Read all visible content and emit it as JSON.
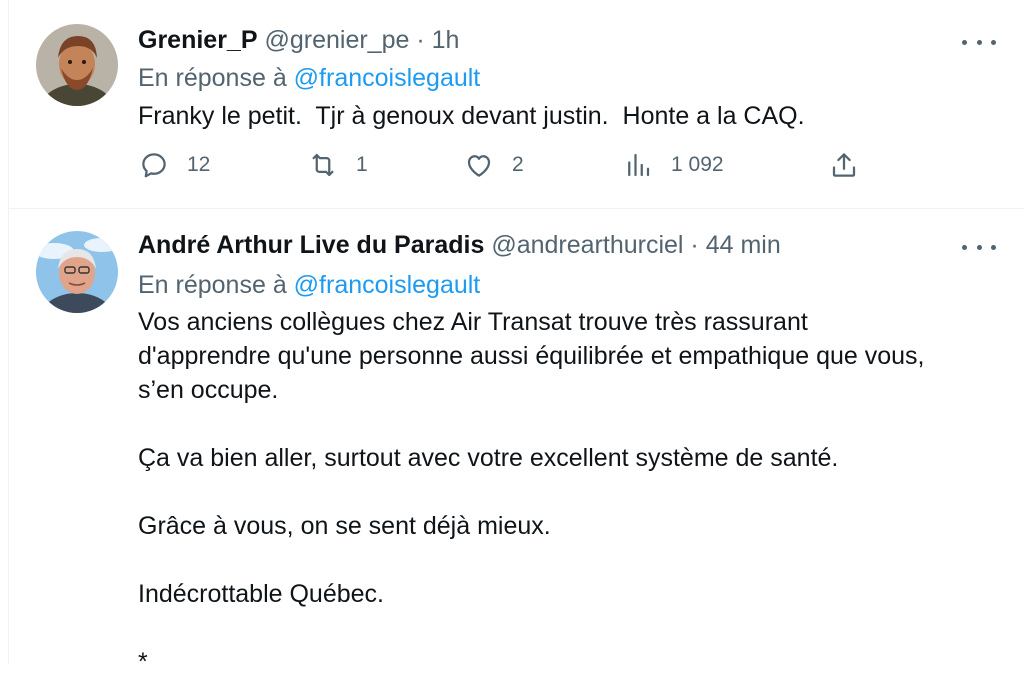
{
  "tweets": [
    {
      "name": "Grenier_P",
      "handle": "@grenier_pe",
      "separator": "·",
      "time": "1h",
      "reply_prefix": "En réponse à",
      "reply_mention": "@francoislegault",
      "text": "Franky le petit.  Tjr à genoux devant justin.  Honte a la CAQ.",
      "stats": {
        "replies": "12",
        "retweets": "1",
        "likes": "2",
        "views": "1 092"
      }
    },
    {
      "name": "André Arthur Live du Paradis",
      "handle": "@andrearthurciel",
      "separator": "·",
      "time": "44 min",
      "reply_prefix": "En réponse à",
      "reply_mention": "@francoislegault",
      "paragraphs": [
        "Vos anciens collègues chez Air Transat trouve très rassurant\nd'apprendre qu'une personne aussi équilibrée et empathique que vous,\ns’en occupe.",
        "Ça va bien aller, surtout avec votre excellent système de santé.",
        "Grâce à vous, on se sent déjà mieux.",
        "Indécrottable Québec.",
        "*"
      ]
    }
  ],
  "icons": {
    "reply": "reply-icon",
    "retweet": "retweet-icon",
    "like": "heart-icon",
    "views": "views-icon",
    "share": "share-icon",
    "more": "more-icon"
  },
  "colors": {
    "text": "#0f1419",
    "secondary": "#536471",
    "link": "#1d9bf0",
    "border": "#eff3f4"
  }
}
